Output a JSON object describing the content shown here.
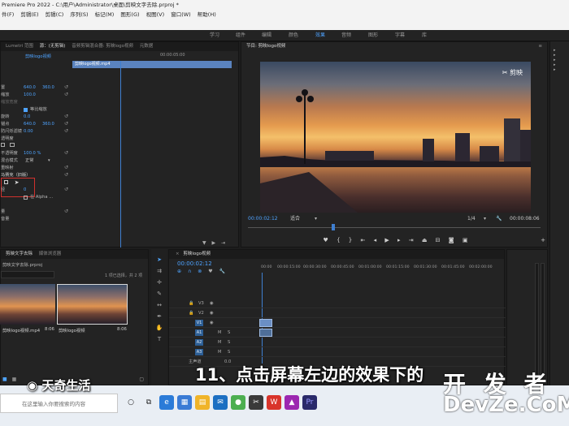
{
  "window": {
    "title": "Premiere Pro 2022 - C:\\用户\\Administrator\\桌面\\剪映文字去除.prproj *"
  },
  "menu": [
    "件(F)",
    "剪辑(E)",
    "剪辑(C)",
    "序列(S)",
    "标记(M)",
    "图形(G)",
    "视图(V)",
    "窗口(W)",
    "帮助(H)"
  ],
  "workspaces": [
    "学习",
    "组件",
    "编辑",
    "颜色",
    "效果",
    "音频",
    "图形",
    "字幕",
    "库"
  ],
  "workspaces_active": "效果",
  "effect_controls": {
    "tabs": [
      "Lumetri 范围",
      "源：(无剪辑)",
      "音频剪辑混合器: 剪映logo视频",
      "元数据"
    ],
    "clip_header": "剪映logo视频",
    "clip_name": "剪映logo视频.mp4",
    "timecode": "00:00:05:00",
    "rows": [
      {
        "label": "置",
        "value": "640.0",
        "value2": "360.0"
      },
      {
        "label": "缩放",
        "value": "100.0"
      },
      {
        "label": "缩放宽度",
        "value": ""
      },
      {
        "label": "",
        "check": "等比缩放"
      },
      {
        "label": "旋转",
        "value": "0.0"
      },
      {
        "label": "锚点",
        "value": "640.0",
        "value2": "360.0"
      },
      {
        "label": "防闪烁滤镜",
        "value": "0.00"
      },
      {
        "label": "透明度",
        "value": ""
      },
      {
        "label": "不透明度",
        "value": "100.0 %"
      },
      {
        "label": "混合模式",
        "value": "正常"
      },
      {
        "label": "重映射",
        "value": ""
      },
      {
        "label": "马赛克（旧版）",
        "value": ""
      },
      {
        "label": "径",
        "value": "0"
      },
      {
        "label": "",
        "check": "在 Alpha ..."
      },
      {
        "label": "量",
        "value": ""
      },
      {
        "label": "音量",
        "value": ""
      }
    ]
  },
  "program": {
    "title": "节目: 剪映logo视频",
    "timecode": "00:00:02:12",
    "fit": "适合",
    "scale": "1/4",
    "duration": "00:00:08:06",
    "watermark": "剪映"
  },
  "project": {
    "tabs": [
      "剪映文字去除",
      "媒体浏览器"
    ],
    "project_file": "剪映文字去除.prproj",
    "selection_info": "1 项已选择，共 2 项",
    "items": [
      {
        "name": "剪映logo视频.mp4",
        "duration": "8:06"
      },
      {
        "name": "剪映logo视频",
        "duration": "8:06"
      }
    ]
  },
  "timeline": {
    "title": "剪映logo视频",
    "timecode": "00:00:02:12",
    "ruler": [
      "00:00",
      "00:00:15:00",
      "00:00:30:00",
      "00:00:45:00",
      "00:01:00:00",
      "00:01:15:00",
      "00:01:30:00",
      "00:01:45:00",
      "00:02:00:00",
      "00:02:15:00"
    ],
    "video_tracks": [
      "V3",
      "V2",
      "V1"
    ],
    "audio_tracks": [
      "A1",
      "A2",
      "A3"
    ],
    "master": "主声道",
    "master_value": "0.0"
  },
  "taskbar": {
    "search_placeholder": "在这里输入你要搜索的内容"
  },
  "overlay": {
    "subtitle": "11、点击屏幕左边的效果下的",
    "brand_left": "天奇生活",
    "brand_right_top": "开 发 者",
    "brand_right_bottom": "DevZe.CoM"
  }
}
